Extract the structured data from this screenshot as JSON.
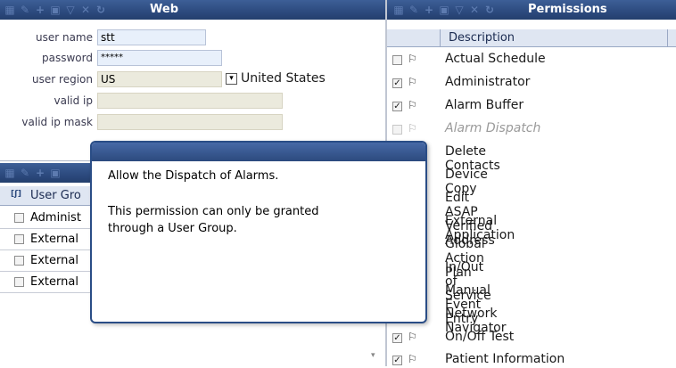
{
  "web_panel": {
    "title": "Web",
    "toolbar_icons": [
      "grid-icon",
      "edit-icon",
      "add-icon",
      "save-icon",
      "filter-icon",
      "delete-icon",
      "refresh-icon"
    ],
    "fields": {
      "user_name_label": "user name",
      "user_name_value": "stt",
      "password_label": "password",
      "password_value": "*****",
      "user_region_label": "user region",
      "user_region_value": "US",
      "user_region_country": "United States",
      "valid_ip_label": "valid ip",
      "valid_ip_value": "",
      "valid_ip_mask_label": "valid ip mask",
      "valid_ip_mask_value": ""
    }
  },
  "groups_panel": {
    "column_header": "User Gro",
    "rows": [
      "Administ",
      "External",
      "External",
      "External"
    ]
  },
  "permissions_panel": {
    "title": "Permissions",
    "column_header": "Description",
    "items": [
      {
        "label": "Actual Schedule",
        "checked": false,
        "disabled": false
      },
      {
        "label": "Administrator",
        "checked": true,
        "disabled": false
      },
      {
        "label": "Alarm Buffer",
        "checked": true,
        "disabled": false
      },
      {
        "label": "Alarm Dispatch",
        "checked": false,
        "disabled": true
      },
      {
        "label": "Delete Contacts"
      },
      {
        "label": "Device Copy"
      },
      {
        "label": "Edit ASAP Verified Address"
      },
      {
        "label": "External Application"
      },
      {
        "label": "Global Action Plan"
      },
      {
        "label": "In/Out of Service"
      },
      {
        "label": "Manual Event Entry"
      },
      {
        "label": "Network Navigator"
      },
      {
        "label": "On/Off Test",
        "checked": true
      },
      {
        "label": "Patient Information",
        "checked": true
      }
    ]
  },
  "tooltip": {
    "line1": "Allow the Dispatch of Alarms.",
    "line2": "This permission can only be granted",
    "line3": "through a User Group."
  },
  "colors": {
    "title_bar": "#2c4a7e",
    "input_bg": "#e8f0fb",
    "disabled_bg": "#ebeadd",
    "tooltip_border": "#2a4d86"
  }
}
